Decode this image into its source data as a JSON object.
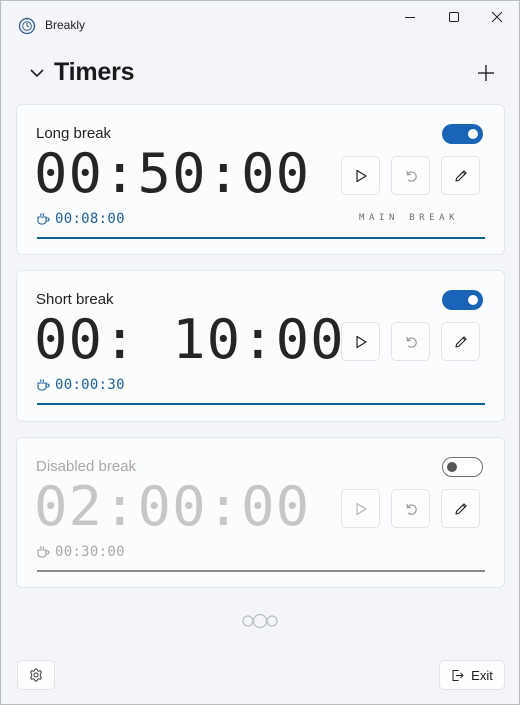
{
  "window": {
    "title": "Breakly",
    "icon": "app-icon",
    "controls": [
      "minimize-icon",
      "maximize-icon",
      "close-icon"
    ]
  },
  "header": {
    "title": "Timers",
    "collapse_icon": "chevron-down-icon",
    "add_icon": "plus-icon"
  },
  "timers": [
    {
      "name": "Long break",
      "enabled": true,
      "time": "00:50:00",
      "break_duration": "00:08:00",
      "badge": "MAIN BREAK",
      "progress": 1.0
    },
    {
      "name": "Short break",
      "enabled": true,
      "time": "00: 10:00",
      "break_duration": "00:00:30",
      "badge": "",
      "progress": 1.0
    },
    {
      "name": "Disabled break",
      "enabled": false,
      "time": "02:00:00",
      "break_duration": "00:30:00",
      "badge": "",
      "progress": 1.0
    }
  ],
  "footer": {
    "exit_label": "Exit",
    "settings_icon": "gear-icon",
    "pager_icon": "carousel-dots-icon"
  },
  "colors": {
    "accent": "#1a64b8",
    "progress": "#0f5e9c",
    "sub_time": "#1e5f9a",
    "disabled": "#c6c6c6"
  }
}
